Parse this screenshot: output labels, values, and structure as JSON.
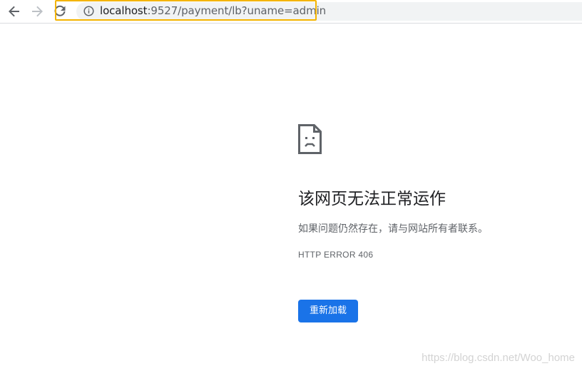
{
  "toolbar": {
    "back_icon": "arrow-left-icon",
    "forward_icon": "arrow-right-icon",
    "reload_icon": "reload-icon",
    "security_icon": "info-icon",
    "url_host": "localhost",
    "url_rest": ":9527/payment/lb?uname=admin",
    "highlight_color": "#f4b400"
  },
  "error": {
    "icon": "sad-page-icon",
    "title": "该网页无法正常运作",
    "message": "如果问题仍然存在，请与网站所有者联系。",
    "code": "HTTP ERROR 406",
    "reload_label": "重新加载"
  },
  "watermark": "https://blog.csdn.net/Woo_home",
  "colors": {
    "accent": "#1a73e8",
    "text_primary": "#202124",
    "text_secondary": "#5f6368",
    "omnibox_bg": "#f1f3f4"
  }
}
